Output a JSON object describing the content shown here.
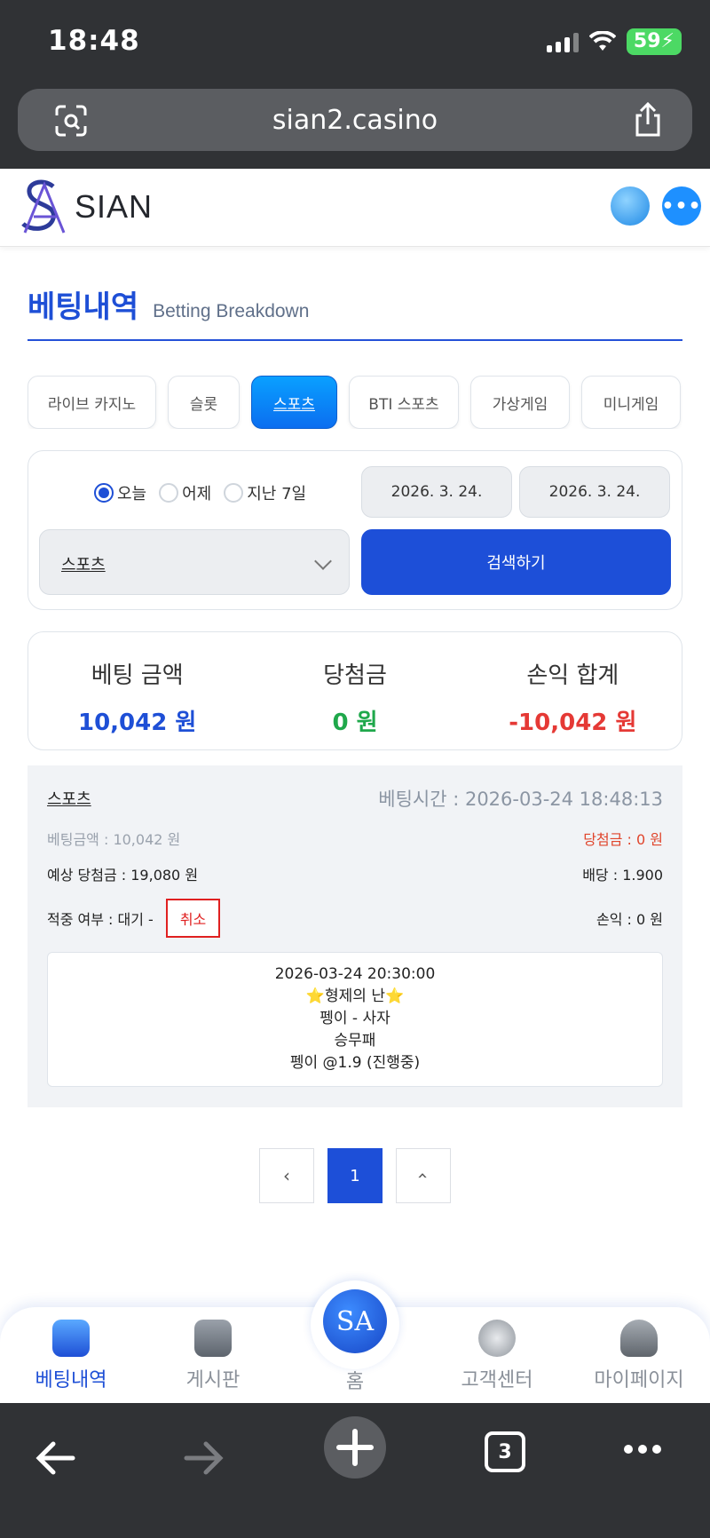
{
  "status_bar": {
    "time": "18:48",
    "battery": "59"
  },
  "browser": {
    "url": "sian2.casino",
    "tab_count": "3"
  },
  "header": {
    "logo_text": "SIAN"
  },
  "page": {
    "title_ko": "베팅내역",
    "title_en": "Betting Breakdown"
  },
  "tabs": [
    {
      "label": "라이브 카지노",
      "active": false
    },
    {
      "label": "슬롯",
      "active": false
    },
    {
      "label": "스포츠",
      "active": true
    },
    {
      "label": "BTI 스포츠",
      "active": false
    },
    {
      "label": "가상게임",
      "active": false
    },
    {
      "label": "미니게임",
      "active": false
    }
  ],
  "filter": {
    "radios": [
      {
        "label": "오늘",
        "selected": true
      },
      {
        "label": "어제",
        "selected": false
      },
      {
        "label": "지난 7일",
        "selected": false
      }
    ],
    "date_start": "2026. 3. 24.",
    "date_end": "2026. 3. 24.",
    "category": "스포츠",
    "search_label": "검색하기"
  },
  "summary": {
    "bet_label": "베팅 금액",
    "bet_value": "10,042 원",
    "win_label": "당첨금",
    "win_value": "0 원",
    "pl_label": "손익 합계",
    "pl_value": "-10,042 원",
    "colors": {
      "bet": "#1e4fd6",
      "win": "#1fa84b",
      "pl": "#e53935"
    }
  },
  "bet": {
    "category": "스포츠",
    "bet_time": "베팅시간 : 2026-03-24 18:48:13",
    "bet_amount": "베팅금액 : 10,042 원",
    "win_amount": "당첨금 : 0 원",
    "expected_win": "예상 당첨금 : 19,080 원",
    "odds": "배당 : 1.900",
    "hit_status": "적중 여부 : 대기 -",
    "cancel_label": "취소",
    "profit": "손익 : 0 원",
    "detail": {
      "datetime": "2026-03-24 20:30:00",
      "event": "⭐형제의 난⭐",
      "match": "펭이 - 사자",
      "market": "승무패",
      "pick": "펭이 @1.9 (진행중)"
    }
  },
  "pagination": {
    "prev": "‹",
    "current": "1",
    "next": "‹"
  },
  "bottom_nav": {
    "betting": "베팅내역",
    "board": "게시판",
    "home": "홈",
    "support": "고객센터",
    "mypage": "마이페이지"
  }
}
